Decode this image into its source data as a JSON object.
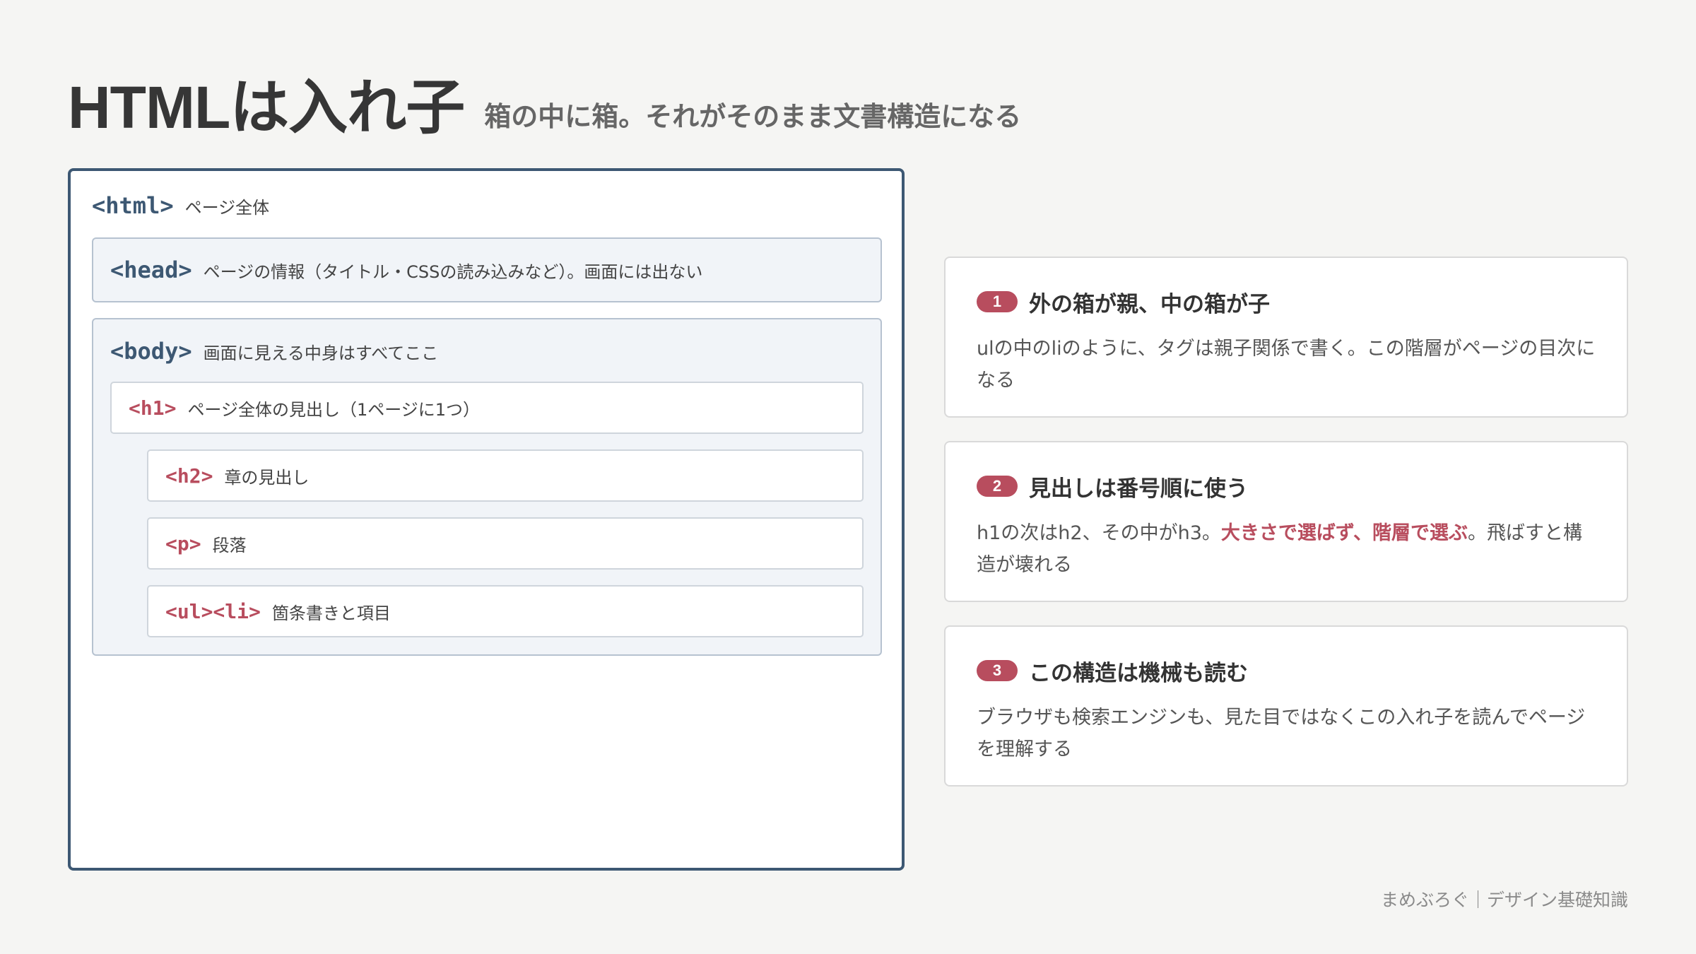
{
  "header": {
    "title": "HTMLは入れ子",
    "subtitle": "箱の中に箱。それがそのまま文書構造になる"
  },
  "diagram": {
    "html": {
      "tag": "<html>",
      "note": "ページ全体"
    },
    "head": {
      "tag": "<head>",
      "note": "ページの情報（タイトル・CSSの読み込みなど）。画面には出ない"
    },
    "body": {
      "tag": "<body>",
      "note": "画面に見える中身はすべてここ"
    },
    "h1": {
      "tag": "<h1>",
      "note": "ページ全体の見出し（1ページに1つ）"
    },
    "h2": {
      "tag": "<h2>",
      "note": "章の見出し"
    },
    "p": {
      "tag": "<p>",
      "note": "段落"
    },
    "ul": {
      "tag": "<ul><li>",
      "note": "箇条書きと項目"
    }
  },
  "cards": [
    {
      "number": "1",
      "title": "外の箱が親、中の箱が子",
      "body": "ulの中のliのように、タグは親子関係で書く。この階層がページの目次になる"
    },
    {
      "number": "2",
      "title": "見出しは番号順に使う",
      "body_before": "h1の次はh2、その中がh3。",
      "body_highlight": "大きさで選ばず、階層で選ぶ",
      "body_after": "。飛ばすと構造が壊れる"
    },
    {
      "number": "3",
      "title": "この構造は機械も読む",
      "body": "ブラウザも検索エンジンも、見た目ではなくこの入れ子を読んでページを理解する"
    }
  ],
  "footer": {
    "credit": "まめぶろぐ｜デザイン基礎知識"
  },
  "colors": {
    "navy": "#3d5873",
    "accent_red": "#b84d5e",
    "nested_bg": "#f1f4f8",
    "page_bg": "#f5f5f3"
  }
}
